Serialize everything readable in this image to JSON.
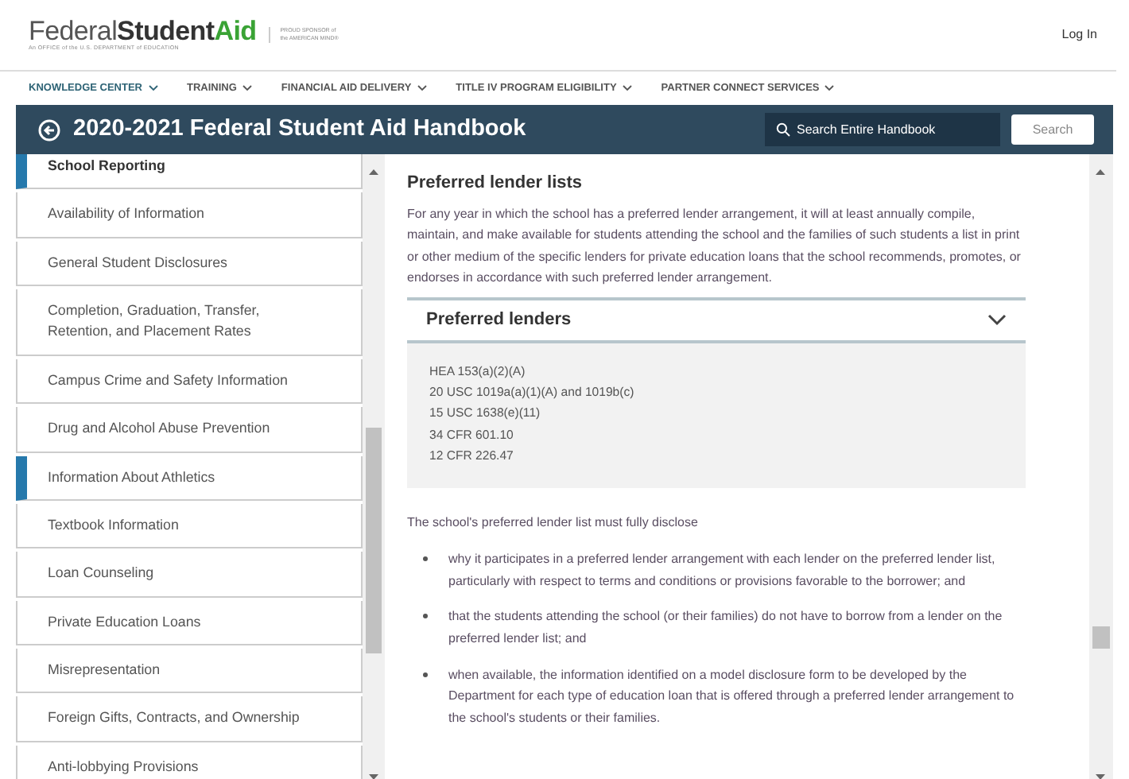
{
  "header": {
    "logo": {
      "word_1": "Federal",
      "word_2": "Student",
      "word_3": "Aid",
      "tagline": "An OFFICE of the U.S. DEPARTMENT of EDUCATION"
    },
    "sponsor": {
      "line_1": "PROUD SPONSOR of",
      "line_2": "the AMERICAN MIND®"
    },
    "login": "Log In"
  },
  "nav": [
    {
      "label": "KNOWLEDGE CENTER",
      "selected": true
    },
    {
      "label": "TRAINING",
      "selected": false
    },
    {
      "label": "FINANCIAL AID DELIVERY",
      "selected": false
    },
    {
      "label": "TITLE IV PROGRAM ELIGIBILITY",
      "selected": false
    },
    {
      "label": "PARTNER CONNECT SERVICES",
      "selected": false
    }
  ],
  "banner": {
    "title": "2020-2021 Federal Student Aid Handbook",
    "search": {
      "placeholder": "Search Entire Handbook"
    },
    "search_button": "Search"
  },
  "sidebar": {
    "items": [
      {
        "label": "School Reporting",
        "kind": "section",
        "active": true
      },
      {
        "label": "Availability of Information",
        "kind": "link",
        "active": false
      },
      {
        "label": "General Student Disclosures",
        "kind": "link",
        "active": false
      },
      {
        "label": "Completion, Graduation, Transfer, Retention, and Placement Rates",
        "kind": "link",
        "active": false
      },
      {
        "label": "Campus Crime and Safety Information",
        "kind": "link",
        "active": false
      },
      {
        "label": "Drug and Alcohol Abuse Prevention",
        "kind": "link",
        "active": false
      },
      {
        "label": "Information About Athletics",
        "kind": "link",
        "active": true
      },
      {
        "label": "Textbook Information",
        "kind": "link",
        "active": false
      },
      {
        "label": "Loan Counseling",
        "kind": "link",
        "active": false
      },
      {
        "label": "Private Education Loans",
        "kind": "link",
        "active": false
      },
      {
        "label": "Misrepresentation",
        "kind": "link",
        "active": false
      },
      {
        "label": "Foreign Gifts, Contracts, and Ownership",
        "kind": "link",
        "active": false
      },
      {
        "label": "Anti-lobbying Provisions",
        "kind": "link",
        "active": false
      }
    ]
  },
  "content": {
    "heading": "Preferred lender lists",
    "intro": "For any year in which the school has a preferred lender arrangement, it will at least annually compile, maintain, and make available for students attending the school and the families of such students a list in print or other medium of the specific lenders for private education loans that the school recommends, promotes, or endorses in accordance with such preferred lender arrangement.",
    "accordion": {
      "title": "Preferred lenders",
      "expanded": true,
      "references": [
        "HEA 153(a)(2)(A)",
        "20 USC 1019a(a)(1)(A) and 1019b(c)",
        "15 USC 1638(e)(11)",
        "34 CFR 601.10",
        "12 CFR 226.47"
      ]
    },
    "lead": "The school's preferred lender list must fully disclose",
    "bullets": [
      "why it participates in a preferred lender arrangement with each lender on the preferred lender list, particularly with respect to terms and conditions or provisions favorable to the borrower; and",
      "that the students attending the school (or their families) do not have to borrow from a lender on the preferred lender list; and",
      "when available, the information identified on a model disclosure form to be developed by the Department for each type of education loan that is offered through a preferred lender arrangement to the school's students or their families."
    ]
  }
}
